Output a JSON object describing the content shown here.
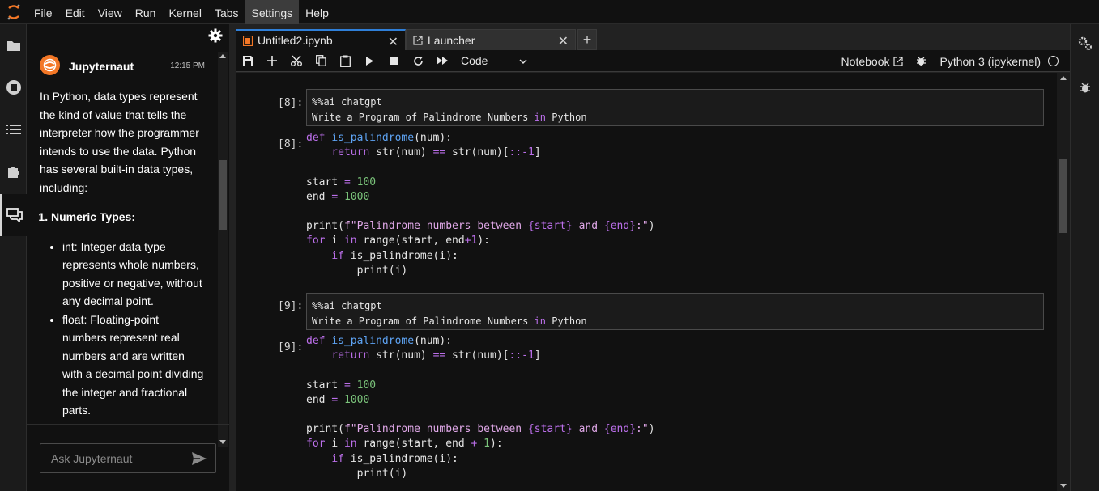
{
  "menubar": {
    "items": [
      "File",
      "Edit",
      "View",
      "Run",
      "Kernel",
      "Tabs",
      "Settings",
      "Help"
    ],
    "active": "Settings"
  },
  "left_sidebar": {
    "icons": [
      "folder-icon",
      "running-icon",
      "toc-icon",
      "extensions-icon",
      "chat-icon"
    ],
    "selected": "chat-icon"
  },
  "chat": {
    "sender": "Jupyternaut",
    "time": "12:15 PM",
    "intro": "In Python, data types represent the kind of value that tells the interpreter how the programmer intends to use the data. Python has several built-in data types, including:",
    "list_heading": "Numeric Types:",
    "bullets": [
      "int: Integer data type represents whole numbers, positive or negative, without any decimal point.",
      "float: Floating-point numbers represent real numbers and are written with a decimal point dividing the integer and fractional parts."
    ],
    "input_placeholder": "Ask Jupyternaut"
  },
  "tabs": [
    {
      "label": "Untitled2.ipynb",
      "active": true
    },
    {
      "label": "Launcher",
      "active": false
    }
  ],
  "toolbar": {
    "cell_type": "Code",
    "notebook_label": "Notebook",
    "kernel_name": "Python 3 (ipykernel)"
  },
  "cells": [
    {
      "prompt_in": "[8]:",
      "magic_line": "%%ai chatgpt",
      "prompt_line_words": [
        "Write a Program of Palindrome Numbers",
        "in",
        "Python"
      ],
      "prompt_out": "[8]:"
    },
    {
      "prompt_in": "[9]:",
      "magic_line": "%%ai chatgpt",
      "prompt_line_words": [
        "Write a Program of Palindrome Numbers",
        "in",
        "Python"
      ],
      "prompt_out": "[9]:"
    }
  ],
  "code": {
    "def": "def",
    "fn_name": "is_palindrome",
    "param": "(num):",
    "return_kw": "return",
    "str_call_1": "str(num)",
    "eq": "==",
    "str_call_2": "str(num)[",
    "slice": "::-1",
    "slice_close": "]",
    "start_var": "start",
    "start_val": "100",
    "end_var": "end",
    "end_val": "1000",
    "assign": "=",
    "print_open": "print(",
    "fstring_prefix": "f",
    "fstring_1": "\"Palindrome numbers between ",
    "fs_start": "{start}",
    "fs_and": "and",
    "fs_end": "{end}",
    "fstring_2": ":\"",
    "print_close": ")",
    "for_kw": "for",
    "loop_var": "i",
    "in_kw": "in",
    "range_a": "range(start, end",
    "range_plus_tight": "+1",
    "range_plus_spaced_op": "+",
    "range_one": "1",
    "range_close": "):",
    "if_kw": "if",
    "if_cond": "is_palindrome(i):",
    "print_i": "print(i)"
  }
}
